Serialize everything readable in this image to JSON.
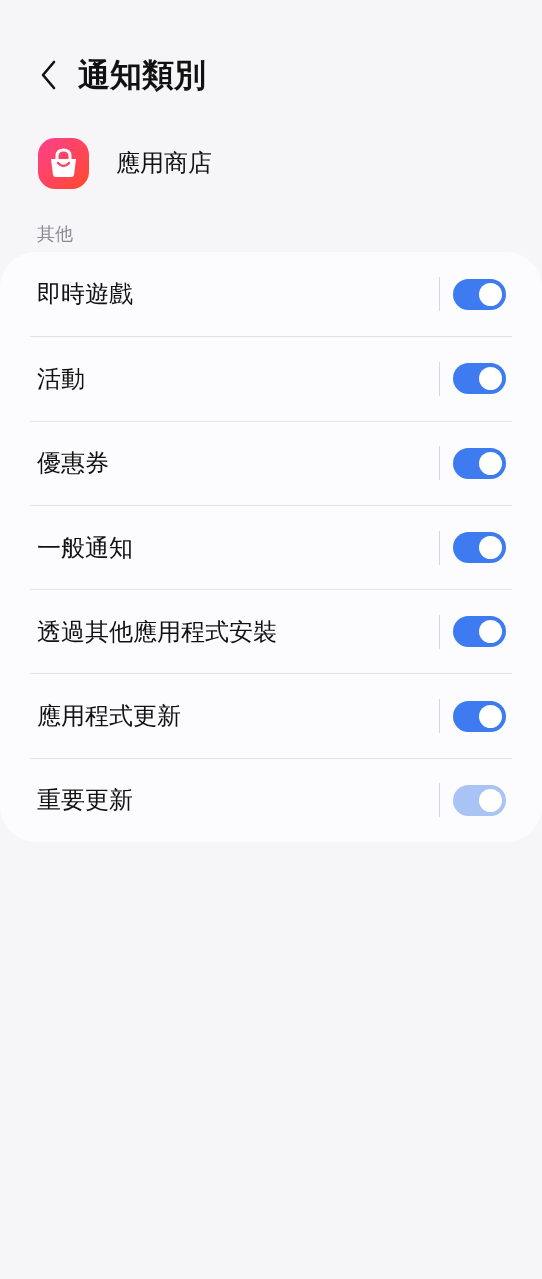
{
  "header": {
    "title": "通知類別"
  },
  "app": {
    "name": "應用商店"
  },
  "section": {
    "title": "其他"
  },
  "items": [
    {
      "label": "即時遊戲",
      "on": true,
      "disabled": false
    },
    {
      "label": "活動",
      "on": true,
      "disabled": false
    },
    {
      "label": "優惠券",
      "on": true,
      "disabled": false
    },
    {
      "label": "一般通知",
      "on": true,
      "disabled": false
    },
    {
      "label": "透過其他應用程式安裝",
      "on": true,
      "disabled": false
    },
    {
      "label": "應用程式更新",
      "on": true,
      "disabled": false
    },
    {
      "label": "重要更新",
      "on": true,
      "disabled": true
    }
  ]
}
